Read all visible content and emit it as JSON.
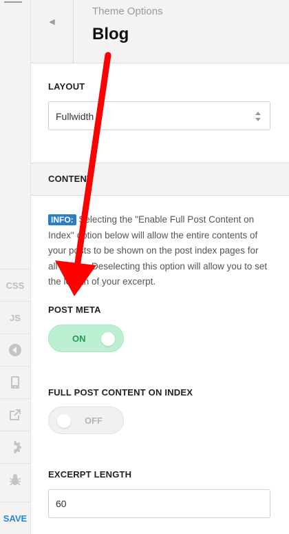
{
  "header": {
    "breadcrumb": "Theme Options",
    "title": "Blog"
  },
  "rail": {
    "tools": [
      {
        "name": "css-button",
        "label": "CSS"
      },
      {
        "name": "js-button",
        "label": "JS"
      }
    ],
    "icons": [
      "back-circle-icon",
      "mobile-preview-icon",
      "external-link-icon",
      "gear-icon",
      "bug-icon"
    ],
    "save_label": "SAVE"
  },
  "layout": {
    "label": "LAYOUT",
    "selected": "Fullwidth"
  },
  "content": {
    "label": "CONTENT",
    "info_badge": "INFO:",
    "info_text": " Selecting the \"Enable Full Post Content on Index\" option below will allow the entire contents of your posts to be shown on the post index pages for all stacks. Deselecting this option will allow you to set the length of your excerpt."
  },
  "post_meta": {
    "label": "POST META",
    "state": "ON"
  },
  "full_post": {
    "label": "FULL POST CONTENT ON INDEX",
    "state": "OFF"
  },
  "excerpt": {
    "label": "EXCERPT LENGTH",
    "value": "60"
  },
  "colors": {
    "accent": "#2a85d6",
    "toggle_on": "#bdefd2",
    "arrow": "#ff0000"
  }
}
